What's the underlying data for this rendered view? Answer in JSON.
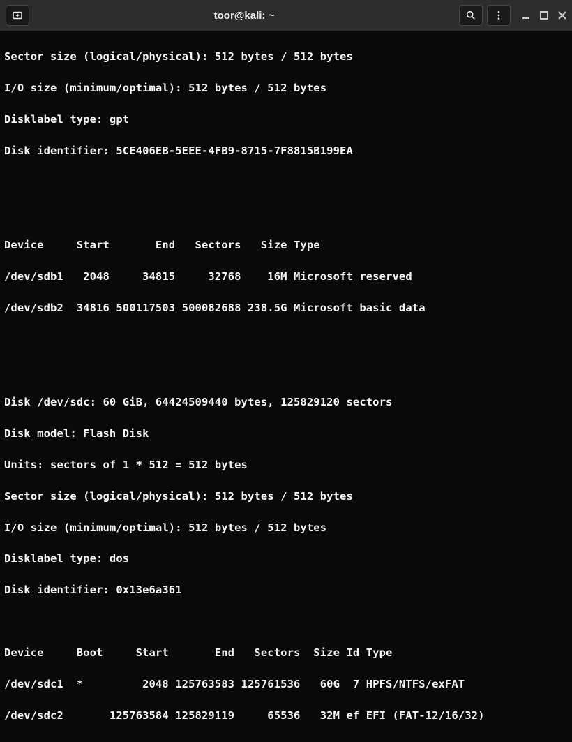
{
  "titlebar": {
    "title": "toor@kali: ~"
  },
  "terminal": {
    "line1": "Sector size (logical/physical): 512 bytes / 512 bytes",
    "line2": "I/O size (minimum/optimal): 512 bytes / 512 bytes",
    "line3": "Disklabel type: gpt",
    "line4": "Disk identifier: 5CE406EB-5EEE-4FB9-8715-7F8815B199EA",
    "blank1": "",
    "blank2": "",
    "header1": "Device     Start       End   Sectors   Size Type",
    "row1": "/dev/sdb1   2048     34815     32768    16M Microsoft reserved",
    "row2": "/dev/sdb2  34816 500117503 500082688 238.5G Microsoft basic data",
    "blank3": "",
    "blank4": "",
    "disk_sdc": "Disk /dev/sdc: 60 GiB, 64424509440 bytes, 125829120 sectors",
    "line5": "Disk model: Flash Disk",
    "line6": "Units: sectors of 1 * 512 = 512 bytes",
    "line7": "Sector size (logical/physical): 512 bytes / 512 bytes",
    "line8": "I/O size (minimum/optimal): 512 bytes / 512 bytes",
    "line9": "Disklabel type: dos",
    "line10": "Disk identifier: 0x13e6a361",
    "blank5": "",
    "header2": "Device     Boot     Start       End   Sectors  Size Id Type",
    "row3": "/dev/sdc1  *         2048 125763583 125761536   60G  7 HPFS/NTFS/exFAT",
    "row4": "/dev/sdc2       125763584 125829119     65536   32M ef EFI (FAT-12/16/32)"
  }
}
